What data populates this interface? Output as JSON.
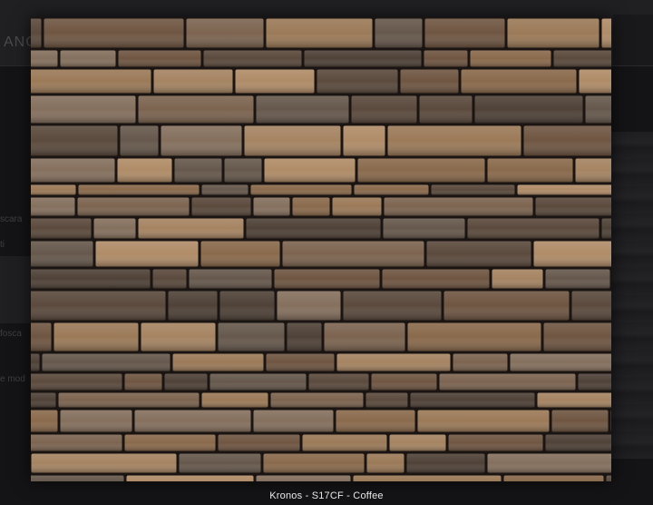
{
  "background_page": {
    "header_text": "ANC",
    "left_snippets": [
      "scara",
      "ti",
      "fosca",
      "e mod"
    ]
  },
  "lightbox": {
    "caption": "Kronos - S17CF - Coffee",
    "colors": {
      "grout": "#1a1512",
      "stone_tones": [
        "#8a6a4c",
        "#6f5642",
        "#9b7a58",
        "#5b4a3d",
        "#a58462",
        "#7c6450",
        "#4f4238",
        "#b08c68",
        "#85705e",
        "#66584c"
      ]
    }
  }
}
